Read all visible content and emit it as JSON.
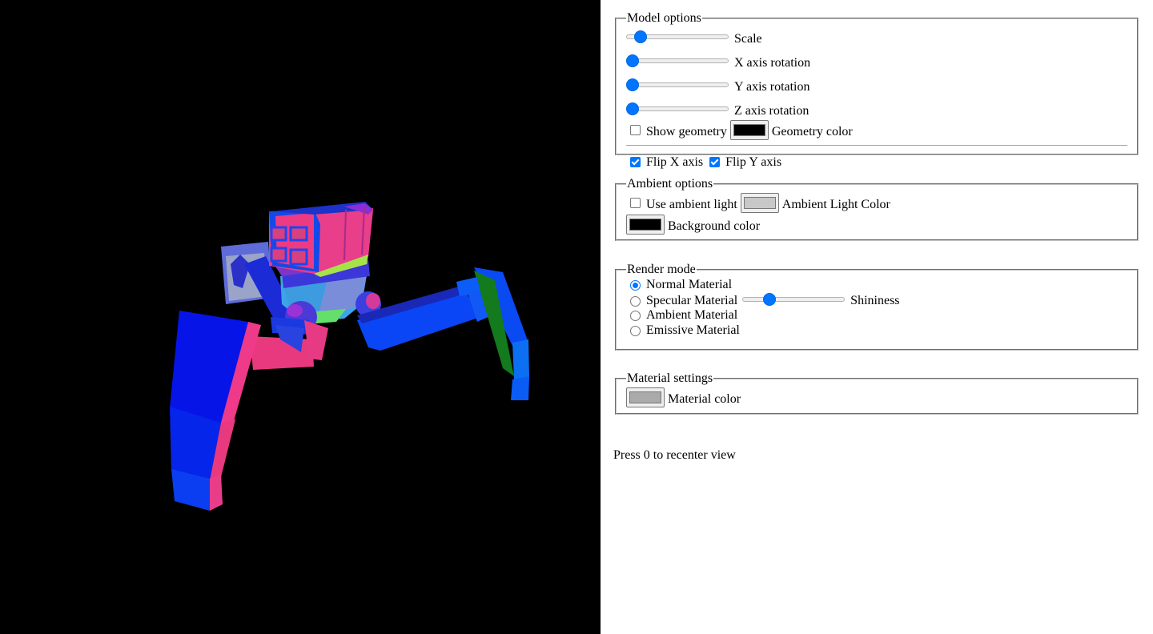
{
  "model_options": {
    "legend": "Model options",
    "sliders": [
      {
        "label": "Scale",
        "value": 0.09
      },
      {
        "label": "X axis rotation",
        "value": 0.0
      },
      {
        "label": "Y axis rotation",
        "value": 0.0
      },
      {
        "label": "Z axis rotation",
        "value": 0.0
      }
    ],
    "show_geometry_label": "Show geometry",
    "show_geometry_checked": false,
    "geometry_color_label": "Geometry color",
    "geometry_color": "#000000",
    "flip_x_label": "Flip X axis",
    "flip_x_checked": true,
    "flip_y_label": "Flip Y axis",
    "flip_y_checked": true
  },
  "ambient_options": {
    "legend": "Ambient options",
    "use_ambient_label": "Use ambient light",
    "use_ambient_checked": false,
    "ambient_color_label": "Ambient Light Color",
    "ambient_color": "#c8c8c8",
    "background_color_label": "Background color",
    "background_color": "#000000"
  },
  "render_mode": {
    "legend": "Render mode",
    "options": [
      {
        "label": "Normal Material",
        "selected": true
      },
      {
        "label": "Specular Material",
        "selected": false
      },
      {
        "label": "Ambient Material",
        "selected": false
      },
      {
        "label": "Emissive Material",
        "selected": false
      }
    ],
    "shininess_label": "Shininess",
    "shininess_value": 0.23
  },
  "material_settings": {
    "legend": "Material settings",
    "material_color_label": "Material color",
    "material_color": "#aaaaaa"
  },
  "hint": "Press 0 to recenter view",
  "colors": {
    "accent": "#0075ff",
    "viewport_background": "#000000"
  }
}
